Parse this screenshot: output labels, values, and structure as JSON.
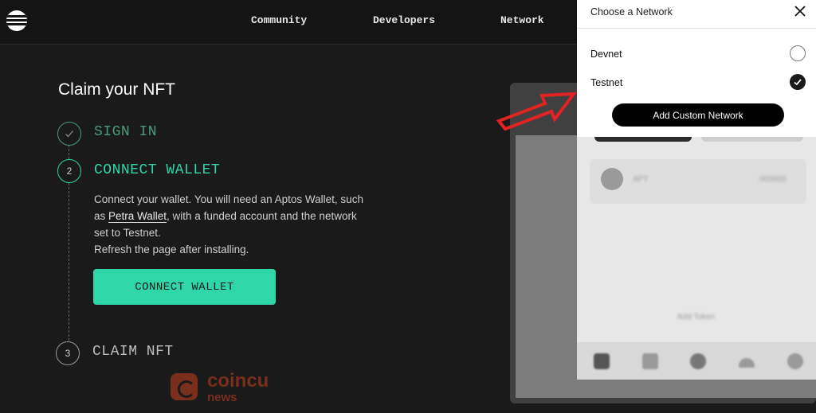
{
  "nav": {
    "links": [
      "Community",
      "Developers",
      "Network"
    ]
  },
  "claim": {
    "title": "Claim your NFT",
    "steps": [
      {
        "num": "",
        "label": "SIGN IN",
        "state": "done"
      },
      {
        "num": "2",
        "label": "CONNECT WALLET",
        "state": "active"
      },
      {
        "num": "3",
        "label": "CLAIM NFT",
        "state": "pending"
      }
    ],
    "description": {
      "line1": "Connect your wallet. You will need an Aptos Wallet, such",
      "line2_pre": "as ",
      "line2_link": "Petra Wallet",
      "line2_post": ", with a funded account and the network",
      "line3": "set to Testnet.",
      "line4": "Refresh the page after installing."
    },
    "connect_button": "CONNECT WALLET"
  },
  "network_panel": {
    "title": "Choose a Network",
    "networks": [
      {
        "name": "Devnet",
        "selected": false
      },
      {
        "name": "Testnet",
        "selected": true
      }
    ],
    "add_button": "Add Custom Network"
  },
  "wallet_preview": {
    "asset_label": "APT",
    "asset_amount": "000000",
    "footer_text": "Add Token"
  },
  "watermark": {
    "line1": "coincu",
    "line2": "news"
  },
  "colors": {
    "accent": "#2ed6a8",
    "step_done": "#4c9a7a",
    "arrow": "#e32222"
  },
  "icons": [
    "aptos-logo-icon",
    "check-icon",
    "close-icon",
    "checkmark-radio-icon",
    "red-arrow-icon"
  ]
}
